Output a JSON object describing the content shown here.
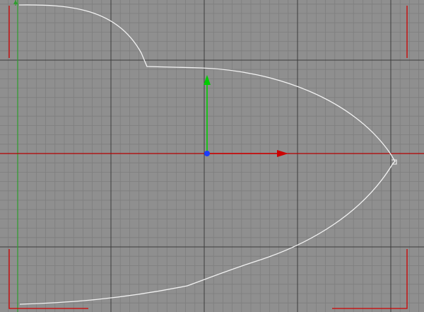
{
  "viewport": {
    "view_name": "",
    "background_color": "#8f8f8f",
    "grid_minor_color": "#7e7e7e",
    "grid_major_color": "#3c3c3c",
    "x_axis_color": "#b40000",
    "world_y_axis_color": "#2e9e2e",
    "safe_frame_color": "#d00000",
    "shape_color": "#f2f2f2"
  },
  "gizmo": {
    "type": "move-transform-gizmo",
    "x_axis_color": "#cc0000",
    "y_axis_color": "#00cc00",
    "pivot_color": "#1a3cff"
  }
}
